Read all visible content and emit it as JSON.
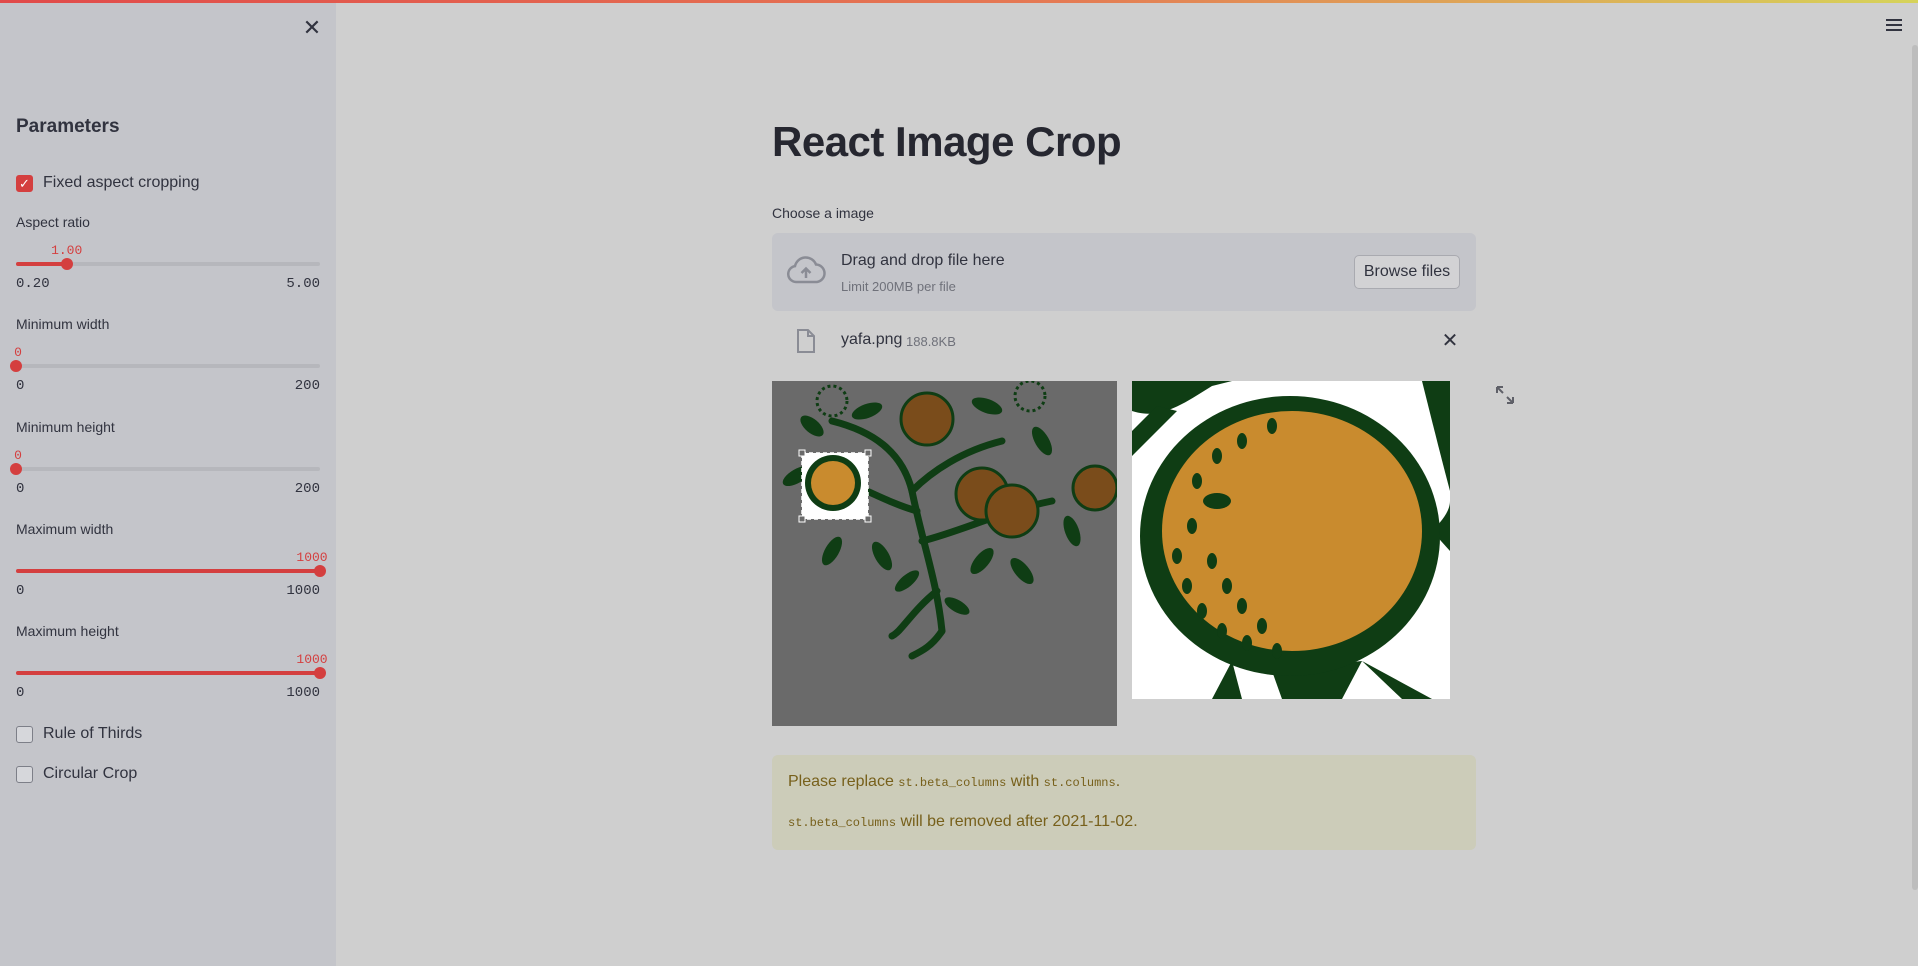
{
  "sidebar": {
    "title": "Parameters",
    "fixed_aspect": {
      "label": "Fixed aspect cropping",
      "checked": true
    },
    "sliders": [
      {
        "label": "Aspect ratio",
        "value": "1.00",
        "min": "0.20",
        "max": "5.00",
        "fraction": 0.1667
      },
      {
        "label": "Minimum width",
        "value": "0",
        "min": "0",
        "max": "200",
        "fraction": 0
      },
      {
        "label": "Minimum height",
        "value": "0",
        "min": "0",
        "max": "200",
        "fraction": 0
      },
      {
        "label": "Maximum width",
        "value": "1000",
        "min": "0",
        "max": "1000",
        "fraction": 1
      },
      {
        "label": "Maximum height",
        "value": "1000",
        "min": "0",
        "max": "1000",
        "fraction": 1
      }
    ],
    "rule_of_thirds": {
      "label": "Rule of Thirds",
      "checked": false
    },
    "circular_crop": {
      "label": "Circular Crop",
      "checked": false
    }
  },
  "main": {
    "title": "React Image Crop",
    "uploader": {
      "label": "Choose a image",
      "drag_text": "Drag and drop file here",
      "limit_text": "Limit 200MB per file",
      "browse_label": "Browse files"
    },
    "file": {
      "name": "yafa.png",
      "size": "188.8KB"
    },
    "alert": {
      "line1_pre": "Please replace ",
      "line1_code1": "st.beta_columns",
      "line1_mid": " with ",
      "line1_code2": "st.columns",
      "line1_post": ".",
      "line2_code": "st.beta_columns",
      "line2_post": " will be removed after 2021-11-02."
    }
  },
  "colors": {
    "accent": "#d43f3f",
    "sidebar_bg": "#c4c5ca",
    "main_bg": "#cfcfcf",
    "alert_bg": "#ccccb9",
    "alert_text": "#77601b"
  },
  "icons": {
    "close": "close-icon",
    "menu": "hamburger-menu-icon",
    "upload": "cloud-upload-icon",
    "file": "file-icon",
    "expand": "fullscreen-expand-icon"
  }
}
